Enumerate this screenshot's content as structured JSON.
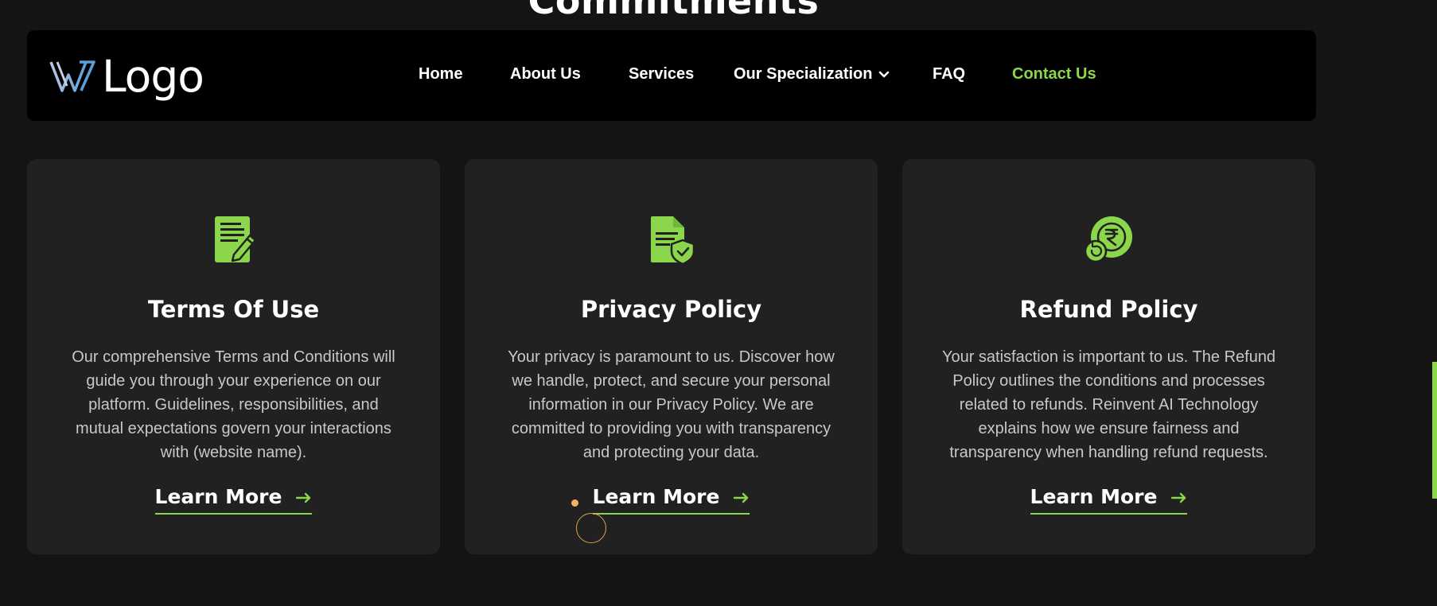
{
  "page": {
    "heading": "Commitments"
  },
  "nav": {
    "logo_text": "Logo",
    "items": [
      {
        "label": "Home"
      },
      {
        "label": "About Us"
      },
      {
        "label": "Services"
      },
      {
        "label": "Our Specialization"
      },
      {
        "label": "FAQ"
      },
      {
        "label": "Contact Us"
      }
    ],
    "active_item": "Contact Us"
  },
  "cards": [
    {
      "icon": "document-edit-icon",
      "title": "Terms Of Use",
      "description": "Our comprehensive Terms and Conditions will guide you through your experience on our platform. Guidelines, responsibilities, and mutual expectations govern your interactions with (website name).",
      "link_label": "Learn More"
    },
    {
      "icon": "document-shield-icon",
      "title": "Privacy Policy",
      "description": "Your privacy is paramount to us. Discover how we handle, protect, and secure your personal information in our Privacy Policy. We are committed to providing you with transparency and protecting your data.",
      "link_label": "Learn More"
    },
    {
      "icon": "rupee-refund-icon",
      "title": "Refund Policy",
      "description": "Your satisfaction is important to us. The Refund Policy outlines the conditions and processes related to refunds. Reinvent AI Technology explains how we ensure fairness and transparency when handling refund requests.",
      "link_label": "Learn More"
    }
  ],
  "colors": {
    "background": "#141414",
    "navbar": "#000000",
    "card": "#212121",
    "accent": "#8bd64a",
    "body_text": "#c8c8c8",
    "cursor": "#f2b65a"
  }
}
